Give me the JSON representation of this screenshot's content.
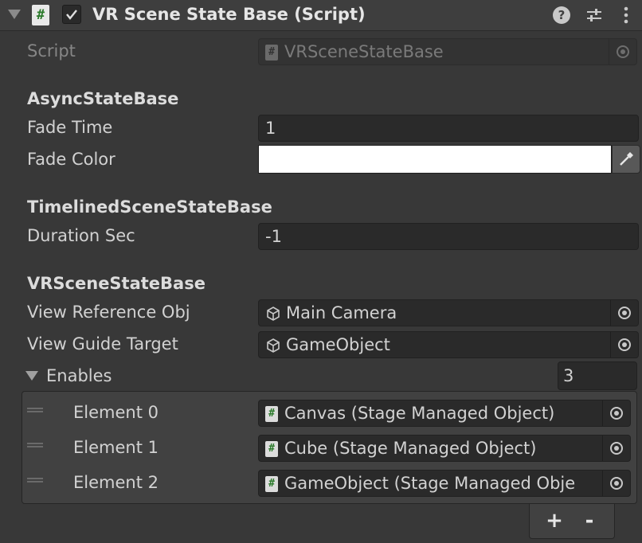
{
  "component": {
    "title": "VR Scene State Base (Script)",
    "enabled": true,
    "script_icon": "#",
    "icons": [
      "foldout-arrow-icon",
      "csharp-script-icon",
      "help-icon",
      "preset-sliders-icon",
      "kebab-menu-icon"
    ]
  },
  "script_row": {
    "label": "Script",
    "value": "VRSceneStateBase",
    "icon": "#"
  },
  "async_section": {
    "header": "AsyncStateBase",
    "fade_time_label": "Fade Time",
    "fade_time_value": "1",
    "fade_color_label": "Fade Color",
    "fade_color_value": "#ffffff"
  },
  "timelined_section": {
    "header": "TimelinedSceneStateBase",
    "duration_label": "Duration Sec",
    "duration_value": "-1"
  },
  "vr_section": {
    "header": "VRSceneStateBase",
    "view_ref_label": "View Reference Obj",
    "view_ref_value": "Main Camera",
    "view_guide_label": "View Guide Target",
    "view_guide_value": "GameObject",
    "enables_label": "Enables",
    "enables_size": "3",
    "elements": [
      {
        "label": "Element 0",
        "value": "Canvas (Stage Managed Object)",
        "icon": "#"
      },
      {
        "label": "Element 1",
        "value": "Cube (Stage Managed Object)",
        "icon": "#"
      },
      {
        "label": "Element 2",
        "value": "GameObject (Stage Managed Obje",
        "icon": "#"
      }
    ],
    "add_label": "+",
    "remove_label": "-"
  },
  "colors": {
    "background": "#383838",
    "field": "#2a2a2a",
    "text": "#d2d2d2",
    "script_icon_green": "#2a7a2a"
  }
}
